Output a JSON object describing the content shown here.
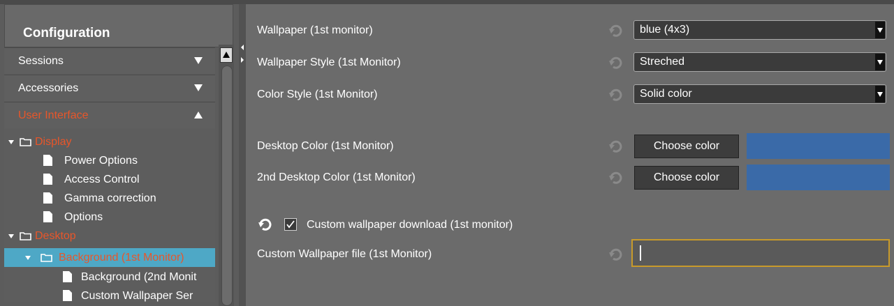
{
  "sidebar": {
    "title": "Configuration",
    "sections": [
      {
        "label": "Sessions",
        "state": "collapsed"
      },
      {
        "label": "Accessories",
        "state": "collapsed"
      },
      {
        "label": "User Interface",
        "state": "expanded"
      }
    ],
    "tree": [
      {
        "label": "Display",
        "type": "folder"
      },
      {
        "label": "Power Options",
        "type": "page"
      },
      {
        "label": "Access Control",
        "type": "page"
      },
      {
        "label": "Gamma correction",
        "type": "page"
      },
      {
        "label": "Options",
        "type": "page"
      },
      {
        "label": "Desktop",
        "type": "folder"
      },
      {
        "label": "Background (1st Monitor)",
        "type": "folder",
        "selected": true
      },
      {
        "label": "Background (2nd Monit",
        "type": "page"
      },
      {
        "label": "Custom Wallpaper Ser",
        "type": "page"
      }
    ]
  },
  "settings": {
    "wallpaper": {
      "label": "Wallpaper (1st monitor)",
      "value": "blue (4x3)"
    },
    "wallpaper_style": {
      "label": "Wallpaper Style (1st Monitor)",
      "value": "Streched"
    },
    "color_style": {
      "label": "Color Style (1st Monitor)",
      "value": "Solid color"
    },
    "desktop_color": {
      "label": "Desktop Color (1st Monitor)",
      "button": "Choose color",
      "color": "#3a6aa8"
    },
    "desktop_color2": {
      "label": "2nd Desktop Color (1st Monitor)",
      "button": "Choose color",
      "color": "#3a6aa8"
    },
    "custom_download": {
      "label": "Custom wallpaper download (1st monitor)",
      "checked": true
    },
    "custom_file": {
      "label": "Custom Wallpaper file (1st Monitor)",
      "value": ""
    }
  },
  "colors": {
    "accent_orange": "#e8562a",
    "selection": "#4ea8c6",
    "input_focus": "#c89a2a"
  }
}
